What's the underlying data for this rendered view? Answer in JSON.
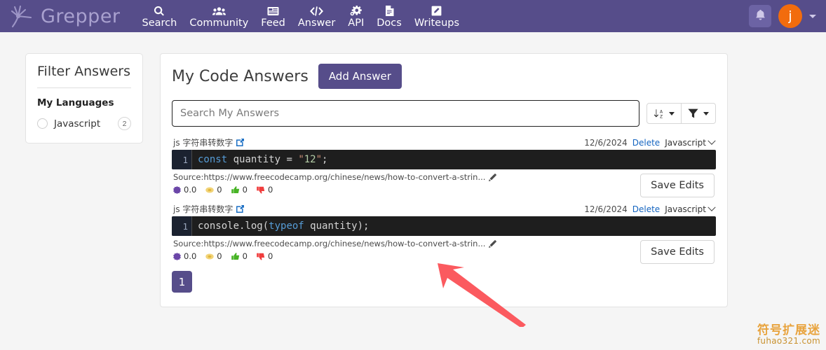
{
  "colors": {
    "brand_purple": "#564d8a",
    "accent_orange": "#f26c0d",
    "link_blue": "#1565c0",
    "page_bg": "#f5f5f5",
    "code_bg": "#1e1e1e",
    "arrow_red": "#fb5a5f",
    "watermark_gold": "#e8a33d"
  },
  "navbar": {
    "brand_name": "Grepper",
    "brand_icon": "grepper-starburst-icon",
    "items": [
      {
        "label": "Search",
        "icon": "search-icon"
      },
      {
        "label": "Community",
        "icon": "people-icon"
      },
      {
        "label": "Feed",
        "icon": "feed-icon"
      },
      {
        "label": "Answer",
        "icon": "code-brackets-icon"
      },
      {
        "label": "API",
        "icon": "gears-icon"
      },
      {
        "label": "Docs",
        "icon": "document-icon"
      },
      {
        "label": "Writeups",
        "icon": "pencil-square-icon"
      }
    ],
    "notifications_icon": "bell-icon",
    "avatar_initial": "j",
    "avatar_caret_icon": "chevron-down-icon"
  },
  "sidebar": {
    "title": "Filter Answers",
    "section_label": "My Languages",
    "languages": [
      {
        "name": "Javascript",
        "count": "2",
        "selected": false
      }
    ]
  },
  "main": {
    "title": "My Code Answers",
    "add_answer_label": "Add Answer",
    "search": {
      "placeholder": "Search My Answers",
      "value": ""
    },
    "toolbar": {
      "sort_icon": "sort-alpha-down-icon",
      "sort_caret_icon": "caret-down-icon",
      "filter_icon": "funnel-icon",
      "filter_caret_icon": "caret-down-icon"
    },
    "answers": [
      {
        "title": "js 字符串转数字",
        "external_link_icon": "external-link-icon",
        "date": "12/6/2024",
        "delete_label": "Delete",
        "language": "Javascript",
        "line_number": "1",
        "code_tokens": [
          {
            "text": "const",
            "type": "kw"
          },
          {
            "text": " quantity = ",
            "type": "plain"
          },
          {
            "text": "\"",
            "type": "str"
          },
          {
            "text": "12",
            "type": "num"
          },
          {
            "text": "\"",
            "type": "str"
          },
          {
            "text": ";",
            "type": "plain"
          }
        ],
        "source_label": "Source:https://www.freecodecamp.org/chinese/news/how-to-convert-a-strin...",
        "edit_icon": "pencil-icon",
        "stats": [
          {
            "icon": "grepper-badge-icon",
            "value": "0.0"
          },
          {
            "icon": "coin-icon",
            "value": "0"
          },
          {
            "icon": "thumbs-up-icon",
            "value": "0"
          },
          {
            "icon": "thumbs-down-icon",
            "value": "0"
          }
        ],
        "save_label": "Save Edits"
      },
      {
        "title": "js 字符串转数字",
        "external_link_icon": "external-link-icon",
        "date": "12/6/2024",
        "delete_label": "Delete",
        "language": "Javascript",
        "line_number": "1",
        "code_tokens": [
          {
            "text": "console.log(",
            "type": "plain"
          },
          {
            "text": "typeof",
            "type": "kw"
          },
          {
            "text": " quantity);",
            "type": "plain"
          }
        ],
        "source_label": "Source:https://www.freecodecamp.org/chinese/news/how-to-convert-a-strin...",
        "edit_icon": "pencil-icon",
        "stats": [
          {
            "icon": "grepper-badge-icon",
            "value": "0.0"
          },
          {
            "icon": "coin-icon",
            "value": "0"
          },
          {
            "icon": "thumbs-up-icon",
            "value": "0"
          },
          {
            "icon": "thumbs-down-icon",
            "value": "0"
          }
        ],
        "save_label": "Save Edits"
      }
    ],
    "pagination": {
      "current_page": "1"
    }
  },
  "annotation": {
    "arrow_icon": "red-arrow-annotation"
  },
  "watermark": {
    "chinese": "符号扩展迷",
    "domain": "fuhao321.com"
  }
}
